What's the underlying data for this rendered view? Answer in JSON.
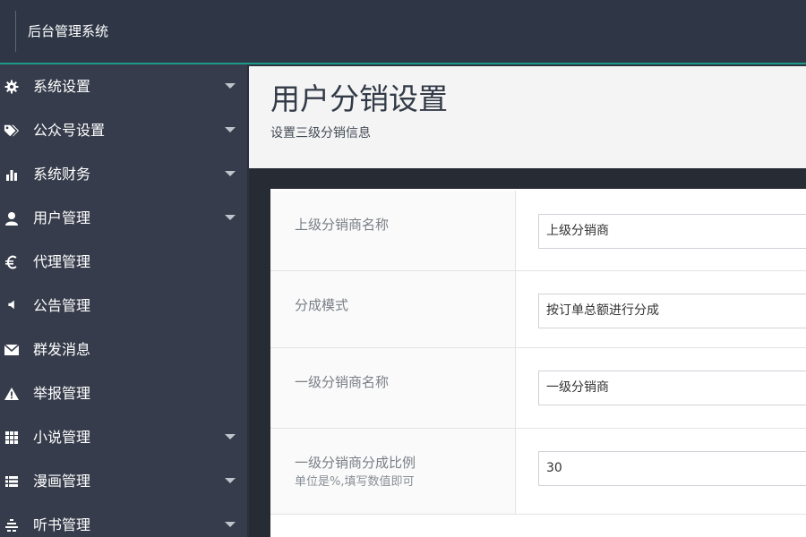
{
  "header": {
    "app_title": "后台管理系统"
  },
  "sidebar": {
    "items": [
      {
        "label": "系统设置",
        "icon": "gear-icon",
        "has_caret": true
      },
      {
        "label": "公众号设置",
        "icon": "tag-icon",
        "has_caret": true
      },
      {
        "label": "系统财务",
        "icon": "bar-chart-icon",
        "has_caret": true
      },
      {
        "label": "用户管理",
        "icon": "user-icon",
        "has_caret": true
      },
      {
        "label": "代理管理",
        "icon": "euro-icon",
        "has_caret": false
      },
      {
        "label": "公告管理",
        "icon": "speaker-icon",
        "has_caret": false
      },
      {
        "label": "群发消息",
        "icon": "envelope-icon",
        "has_caret": false
      },
      {
        "label": "举报管理",
        "icon": "warning-icon",
        "has_caret": false
      },
      {
        "label": "小说管理",
        "icon": "grid-icon",
        "has_caret": true
      },
      {
        "label": "漫画管理",
        "icon": "list-icon",
        "has_caret": true
      },
      {
        "label": "听书管理",
        "icon": "equalizer-icon",
        "has_caret": true
      }
    ]
  },
  "page": {
    "title": "用户分销设置",
    "subtitle": "设置三级分销信息"
  },
  "form": {
    "rows": [
      {
        "label": "上级分销商名称",
        "value": "上级分销商"
      },
      {
        "label": "分成模式",
        "value": "按订单总额进行分成"
      },
      {
        "label": "一级分销商名称",
        "value": "一级分销商"
      },
      {
        "label": "一级分销商分成比例",
        "hint": "单位是%,填写数值即可",
        "value": "30"
      }
    ]
  },
  "colors": {
    "header_bg": "#2f3747",
    "accent": "#1e9a8a",
    "sidebar_bg": "#363c4b"
  }
}
